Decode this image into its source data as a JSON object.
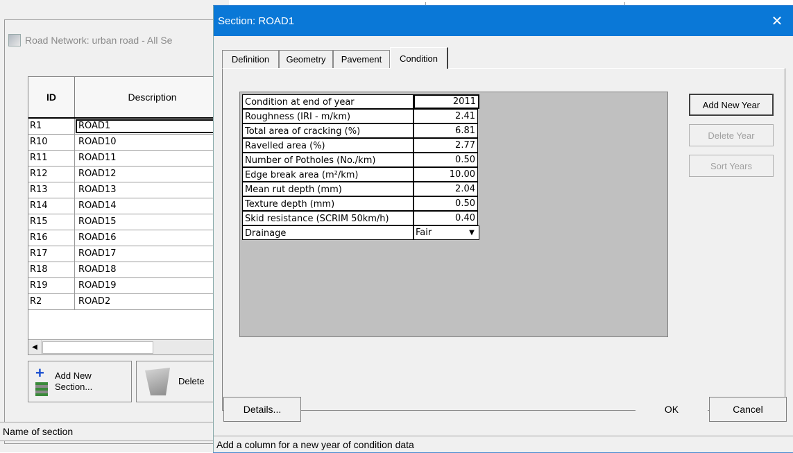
{
  "background_window": {
    "title": "Road Network: urban road - All Se",
    "grid": {
      "headers": {
        "id": "ID",
        "description": "Description"
      },
      "rows": [
        {
          "id": "R1",
          "description": "ROAD1"
        },
        {
          "id": "R10",
          "description": "ROAD10"
        },
        {
          "id": "R11",
          "description": "ROAD11"
        },
        {
          "id": "R12",
          "description": "ROAD12"
        },
        {
          "id": "R13",
          "description": "ROAD13"
        },
        {
          "id": "R14",
          "description": "ROAD14"
        },
        {
          "id": "R15",
          "description": "ROAD15"
        },
        {
          "id": "R16",
          "description": "ROAD16"
        },
        {
          "id": "R17",
          "description": "ROAD17"
        },
        {
          "id": "R18",
          "description": "ROAD18"
        },
        {
          "id": "R19",
          "description": "ROAD19"
        },
        {
          "id": "R2",
          "description": "ROAD2"
        }
      ]
    },
    "buttons": {
      "add_section_line1": "Add New",
      "add_section_line2": "Section...",
      "delete": "Delete"
    },
    "status": "Name of section"
  },
  "dialog": {
    "title": "Section: ROAD1",
    "close_glyph": "✕",
    "tabs": [
      {
        "label": "Definition",
        "active": false
      },
      {
        "label": "Geometry",
        "active": false
      },
      {
        "label": "Pavement",
        "active": false
      },
      {
        "label": "Condition",
        "active": true
      }
    ],
    "condition_rows": [
      {
        "label": "Condition at end of year",
        "value": "2011"
      },
      {
        "label": "Roughness (IRI - m/km)",
        "value": "2.41"
      },
      {
        "label": "Total area of cracking (%)",
        "value": "6.81"
      },
      {
        "label": "Ravelled area (%)",
        "value": "2.77"
      },
      {
        "label": "Number of Potholes (No./km)",
        "value": "0.50"
      },
      {
        "label": "Edge break area (m²/km)",
        "value": "10.00"
      },
      {
        "label": "Mean rut depth (mm)",
        "value": "2.04"
      },
      {
        "label": "Texture depth (mm)",
        "value": "0.50"
      },
      {
        "label": "Skid resistance (SCRIM 50km/h)",
        "value": "0.40"
      },
      {
        "label": "Drainage",
        "value": "Fair"
      }
    ],
    "side_buttons": {
      "add_year": "Add New Year",
      "delete_year": "Delete Year",
      "sort_years": "Sort Years"
    },
    "footer_buttons": {
      "details": "Details...",
      "ok": "OK",
      "cancel": "Cancel"
    },
    "status": "Add a column for a new year of condition data"
  },
  "colors": {
    "titlebar": "#0a78d7",
    "condition_area": "#c0c0c0",
    "window_bg": "#f0f0f0"
  }
}
